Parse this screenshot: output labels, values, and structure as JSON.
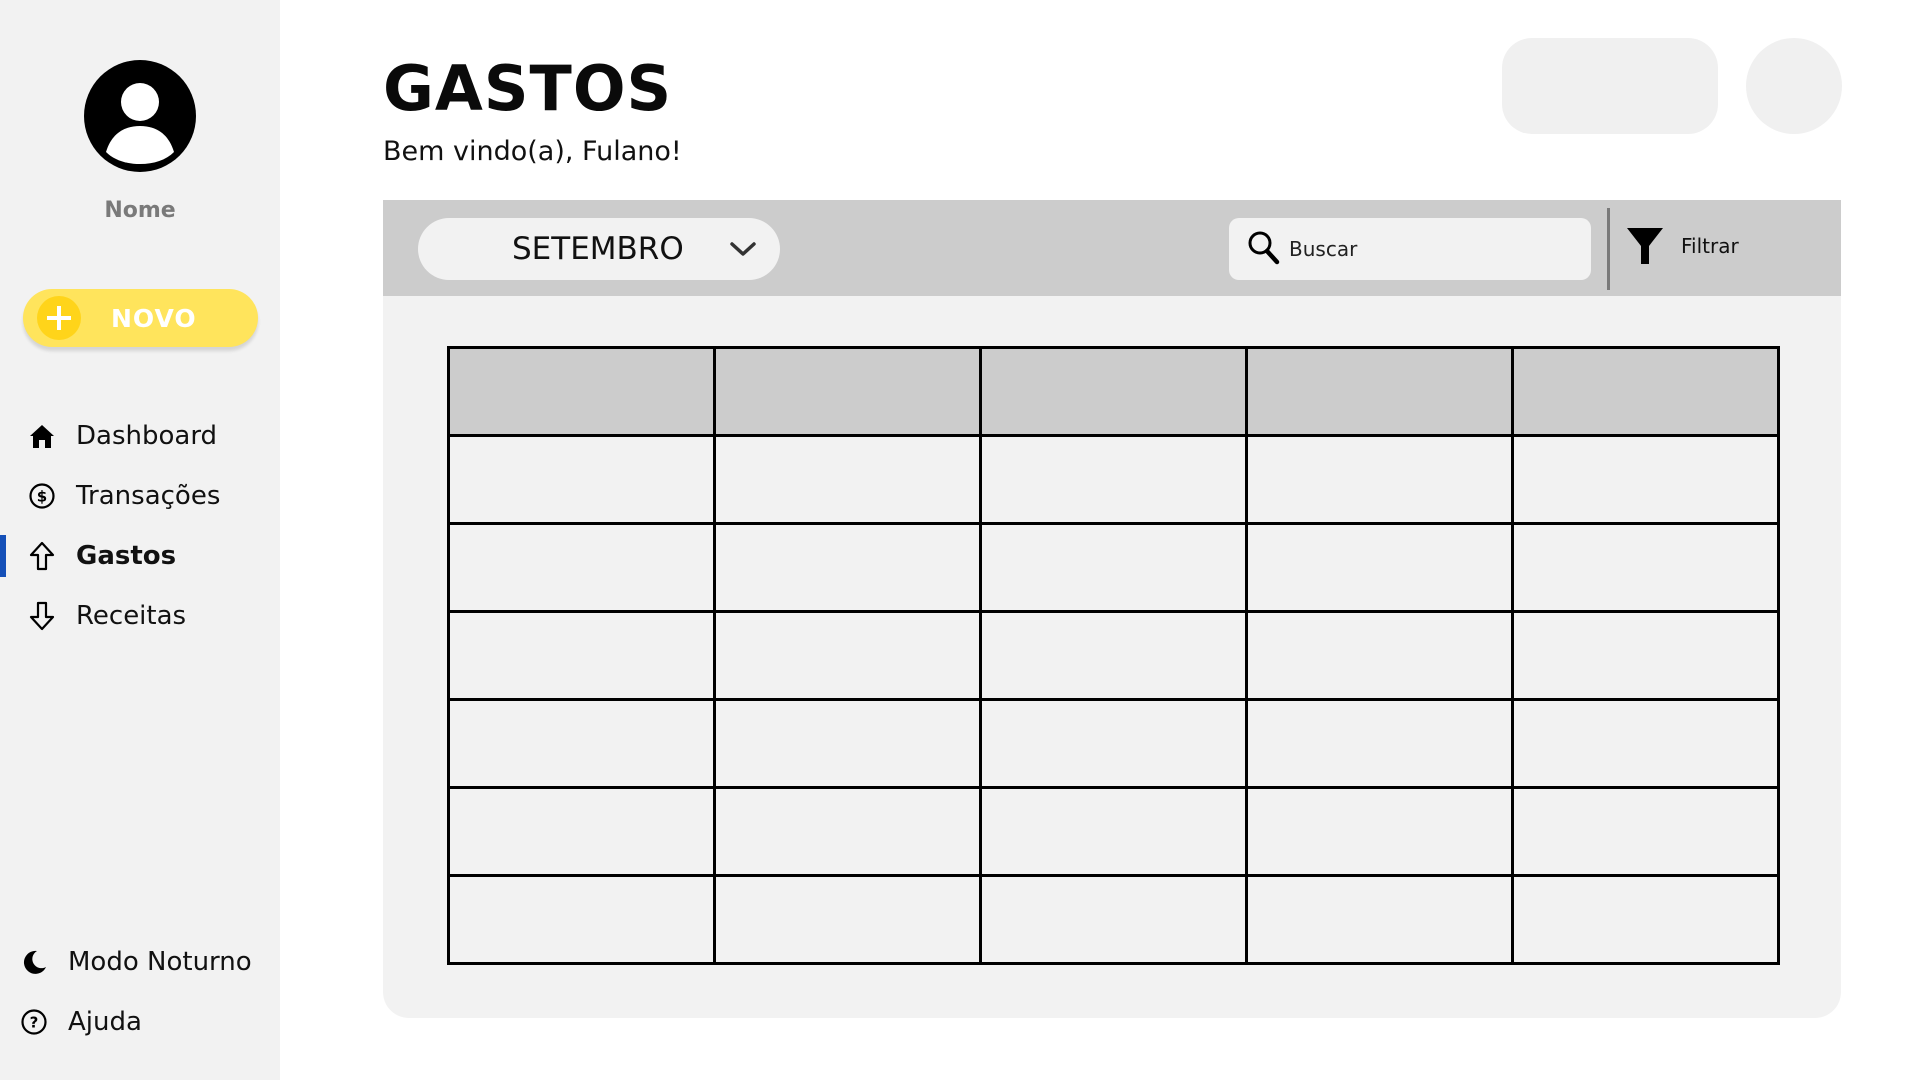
{
  "sidebar": {
    "user_name": "Nome",
    "new_button_label": "NOVO",
    "nav_items": [
      {
        "label": "Dashboard",
        "icon": "home-icon"
      },
      {
        "label": "Transações",
        "icon": "dollar-circle-icon"
      },
      {
        "label": "Gastos",
        "icon": "arrow-up-icon",
        "active": true
      },
      {
        "label": "Receitas",
        "icon": "arrow-down-icon"
      }
    ],
    "bottom_items": [
      {
        "label": "Modo Noturno",
        "icon": "moon-icon"
      },
      {
        "label": "Ajuda",
        "icon": "help-circle-icon"
      }
    ]
  },
  "header": {
    "title": "GASTOS",
    "welcome": "Bem vindo(a), Fulano!"
  },
  "toolbar": {
    "month_selected": "SETEMBRO",
    "search_placeholder": "Buscar",
    "filter_label": "Filtrar"
  },
  "table": {
    "columns": 5,
    "header_cells": [
      "",
      "",
      "",
      "",
      ""
    ],
    "rows": [
      [
        "",
        "",
        "",
        "",
        ""
      ],
      [
        "",
        "",
        "",
        "",
        ""
      ],
      [
        "",
        "",
        "",
        "",
        ""
      ],
      [
        "",
        "",
        "",
        "",
        ""
      ],
      [
        "",
        "",
        "",
        "",
        ""
      ],
      [
        "",
        "",
        "",
        "",
        ""
      ]
    ]
  },
  "colors": {
    "sidebar_bg": "#f2f2f2",
    "accent_yellow": "#ffe45c",
    "active_indicator": "#1550b8",
    "toolbar_bg": "#cccccc",
    "panel_bg": "#f2f2f2"
  }
}
